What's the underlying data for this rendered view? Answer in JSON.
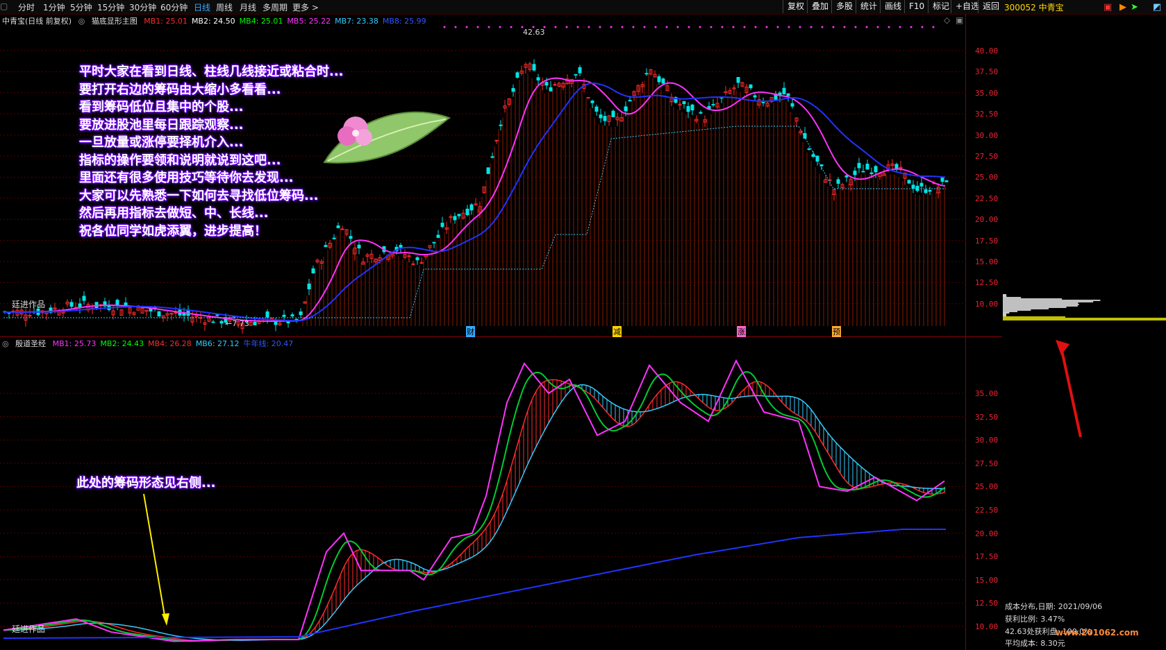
{
  "toolbar": {
    "periods": [
      "分时",
      "1分钟",
      "5分钟",
      "15分钟",
      "30分钟",
      "60分钟",
      "日线",
      "周线",
      "月线",
      "多周期",
      "更多 >"
    ],
    "active_period": "日线",
    "right_buttons": [
      "复权",
      "叠加",
      "多股",
      "统计",
      "画线",
      "F10",
      "标记",
      "+自选",
      "返回"
    ]
  },
  "stock": {
    "code": "300052",
    "name": "中青宝"
  },
  "main_chart": {
    "title": "中青宝(日线 前复权)",
    "indicator_name": "猫底显形主图",
    "legend": [
      {
        "label": "MB1: 25.01",
        "color": "#ff2b2b"
      },
      {
        "label": "MB2: 24.50",
        "color": "#ffffff"
      },
      {
        "label": "MB4: 25.01",
        "color": "#00ff00"
      },
      {
        "label": "MB5: 25.22",
        "color": "#ff33ff"
      },
      {
        "label": "MB7: 23.38",
        "color": "#33ccff"
      },
      {
        "label": "MB8: 25.99",
        "color": "#3355ff"
      }
    ],
    "y_ticks": [
      "40.00",
      "37.50",
      "35.00",
      "32.50",
      "30.00",
      "27.50",
      "25.00",
      "22.50",
      "20.00",
      "17.50",
      "15.00",
      "12.50",
      "10.00"
    ],
    "high_label": "42.63",
    "low_label": "7.73",
    "author_label": "廷进作品",
    "events": [
      "财",
      "减",
      "涨",
      "预"
    ],
    "annotation_lines": [
      "平时大家在看到日线、柱线几线接近或粘合时...",
      "要打开右边的筹码由大缩小多看看...",
      "看到筹码低位且集中的个股...",
      "要放进股池里每日跟踪观察...",
      "一旦放量或涨停要择机介入...",
      "指标的操作要领和说明就说到这吧...",
      "里面还有很多使用技巧等待你去发现...",
      "大家可以先熟悉一下如何去寻找低位筹码...",
      "然后再用指标去做短、中、长线...",
      "祝各位同学如虎添翼，进步提高！"
    ]
  },
  "sub_chart": {
    "indicator_name": "殷道圣经",
    "legend": [
      {
        "label": "MB1: 25.73",
        "color": "#ff33ff"
      },
      {
        "label": "MB2: 24.43",
        "color": "#00ff00"
      },
      {
        "label": "MB4: 26.28",
        "color": "#ff2b2b"
      },
      {
        "label": "MB6: 27.12",
        "color": "#33ccff"
      },
      {
        "label": "牛年线: 20.47",
        "color": "#3355ff"
      }
    ],
    "y_ticks": [
      "35.00",
      "32.50",
      "30.00",
      "27.50",
      "25.00",
      "22.50",
      "20.00",
      "17.50",
      "15.00",
      "12.50",
      "10.00"
    ],
    "annotation": "此处的筹码形态见右侧...",
    "author_label": "廷进作品"
  },
  "chip_panel": {
    "date_line": "成本分布,日期: 2021/09/06",
    "profit_ratio": "获利比例: 3.47%",
    "profit_line": "42.63处获利盘: 100.0%",
    "avg_cost": "平均成本: 8.30元"
  },
  "watermark": "www.201062.com",
  "colors": {
    "up": "#ff2b2b",
    "down": "#00e5e5",
    "axis": "#e23",
    "frame": "#8a0000"
  }
}
